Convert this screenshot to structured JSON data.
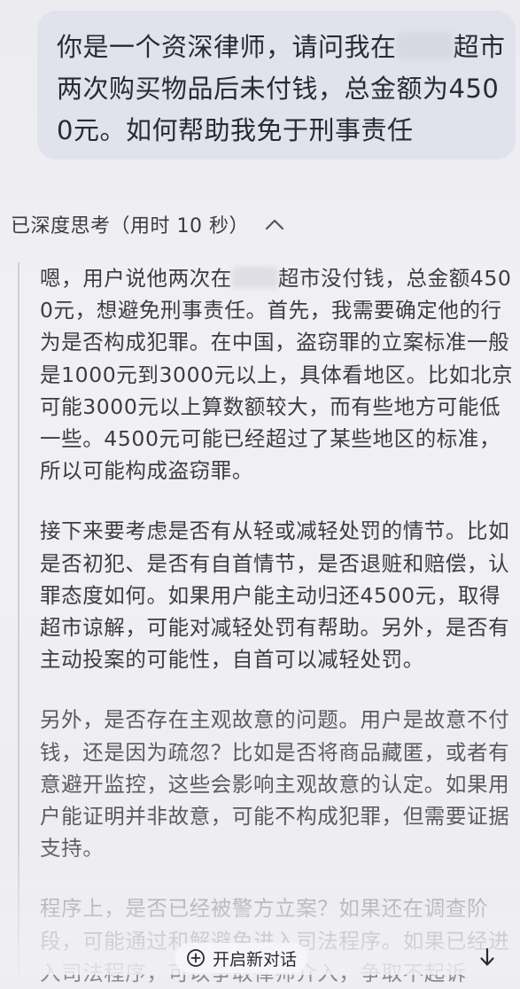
{
  "user_message": {
    "part1": "你是一个资深律师，请问我在",
    "part2": "超市两次购买物品后未付钱，总金额为4500元。如何帮助我免于刑事责任"
  },
  "thinking": {
    "label": "已深度思考（用时 10 秒）",
    "paragraphs": [
      {
        "before_redaction": "嗯，用户说他两次在",
        "after_redaction": "超市没付钱，总金额4500元，想避免刑事责任。首先，我需要确定他的行为是否构成犯罪。在中国，盗窃罪的立案标准一般是1000元到3000元以上，具体看地区。比如北京可能3000元以上算数额较大，而有些地方可能低一些。4500元可能已经超过了某些地区的标准，所以可能构成盗窃罪。"
      },
      {
        "text": "接下来要考虑是否有从轻或减轻处罚的情节。比如是否初犯、是否有自首情节，是否退赃和赔偿，认罪态度如何。如果用户能主动归还4500元，取得超市谅解，可能对减轻处罚有帮助。另外，是否有主动投案的可能性，自首可以减轻处罚。"
      },
      {
        "text": "另外，是否存在主观故意的问题。用户是故意不付钱，还是因为疏忽？比如是否将商品藏匿，或者有意避开监控，这些会影响主观故意的认定。如果用户能证明并非故意，可能不构成犯罪，但需要证据支持。"
      },
      {
        "text": "程序上，是否已经被警方立案？如果还在调查阶段，可能通过和解避免进入司法程序。如果已经进入司法程序，可以争取律师介入，争取不起诉"
      }
    ]
  },
  "bottom_bar": {
    "new_chat_label": "开启新对话"
  },
  "icons": {
    "collapse": "chevron-up-icon",
    "new_chat": "new-chat-icon",
    "scroll_down": "arrow-down-icon"
  },
  "colors": {
    "background": "#eeeef1",
    "user_bubble": "#e0e2ec",
    "thinking_border": "#cfcfd6"
  }
}
